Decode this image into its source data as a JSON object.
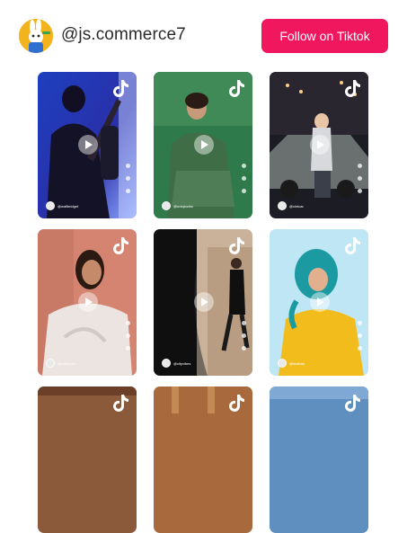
{
  "header": {
    "handle": "@js.commerce7",
    "follow_label": "Follow on Tiktok"
  },
  "colors": {
    "accent": "#f1175e",
    "avatar_bg": "#f2b31c"
  },
  "icons": [
    "tiktok-logo-icon",
    "play-icon",
    "heart-icon",
    "comment-icon",
    "share-icon"
  ],
  "videos": [
    {
      "author": "@wallbridget",
      "scene": "guitarist-blue"
    },
    {
      "author": "@uniqlochic",
      "scene": "green-jacket"
    },
    {
      "author": "@vintcar",
      "scene": "car-night"
    },
    {
      "author": "@softlooks",
      "scene": "white-coat"
    },
    {
      "author": "@cityvibes",
      "scene": "street-shadow"
    },
    {
      "author": "@tealhair",
      "scene": "teal-hair-yellow"
    },
    {
      "author": "",
      "scene": "partial-1"
    },
    {
      "author": "",
      "scene": "partial-2"
    },
    {
      "author": "",
      "scene": "partial-3"
    }
  ]
}
